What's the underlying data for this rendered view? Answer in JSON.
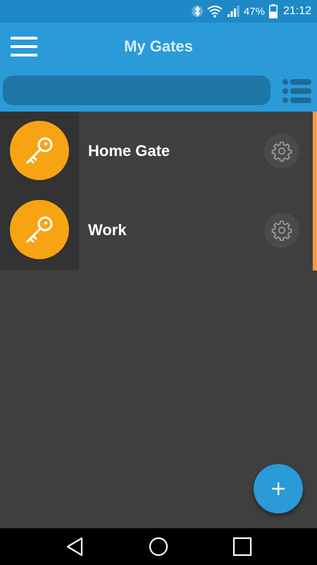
{
  "status_bar": {
    "battery_percent": "47%",
    "time": "21:12",
    "icons": [
      "bluetooth-icon",
      "wifi-icon",
      "signal-icon",
      "battery-icon"
    ]
  },
  "app_bar": {
    "title": "My Gates",
    "menu_icon": "hamburger-menu-icon"
  },
  "search": {
    "value": "",
    "placeholder": "",
    "list_toggle_icon": "list-view-icon"
  },
  "gates": [
    {
      "name": "Home Gate",
      "icon": "key-icon",
      "settings_icon": "gear-icon"
    },
    {
      "name": "Work",
      "icon": "key-icon",
      "settings_icon": "gear-icon"
    }
  ],
  "fab": {
    "label": "+",
    "icon": "plus-icon"
  },
  "nav_bar": {
    "buttons": [
      "back-icon",
      "home-icon",
      "recents-icon"
    ]
  },
  "colors": {
    "primary": "#2a9ad9",
    "status_bar": "#1e89c6",
    "accent": "#f7a414",
    "scroll_indicator": "#f59a43",
    "background": "#3f3f3f"
  }
}
